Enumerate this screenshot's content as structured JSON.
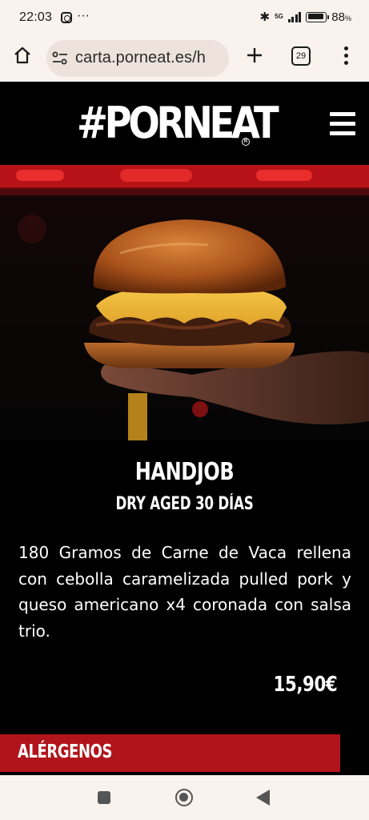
{
  "status_bar": {
    "time": "22:03",
    "dots": "···",
    "network": "5G",
    "battery_pct": "88",
    "battery_pct_unit": "%"
  },
  "browser": {
    "url": "carta.porneat.es/h",
    "tab_count": "29"
  },
  "site": {
    "logo_text": "#PORNEAT",
    "logo_mark": "R"
  },
  "product": {
    "name": "HANDJOB",
    "subtitle": "DRY AGED 30 DÍAS",
    "description": "180 Gramos de Carne de Vaca rellena con cebolla caramelizada pulled pork y queso americano x4 coronada con salsa trio.",
    "price": "15,90€"
  },
  "allergens": {
    "label": "ALÉRGENOS"
  },
  "colors": {
    "accent": "#b1151b",
    "chrome_bg": "#f9f2ed",
    "page_bg": "#000000"
  }
}
